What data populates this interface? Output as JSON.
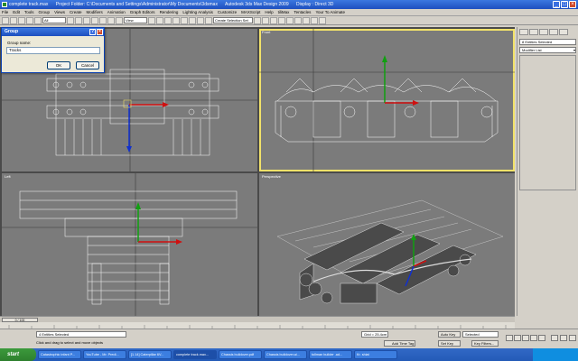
{
  "window": {
    "file": "complete track.max",
    "folder": "Project Folder: C:\\Documents and Settings\\Administrator\\My Documents\\3dsmax",
    "app": "Autodesk 3ds Max Design 2009",
    "display": "Display : Direct 3D"
  },
  "menu": [
    "File",
    "Edit",
    "Tools",
    "Group",
    "Views",
    "Create",
    "Modifiers",
    "Animation",
    "Graph Editors",
    "Rendering",
    "Lighting Analysis",
    "Customize",
    "MAXScript",
    "Help",
    "tiliMax",
    "Tentacles",
    "Your To Animate"
  ],
  "toolbar": {
    "filter": "All",
    "view": "View",
    "selection_set": "Create Selection Set"
  },
  "viewports": {
    "top": "Top",
    "front": "Front",
    "left": "Left",
    "perspective": "Perspective"
  },
  "command_panel": {
    "selection": "8 Entities Selected",
    "modifier_list": "Modifier List"
  },
  "timeline": {
    "slider": "0 / 100"
  },
  "status": {
    "selected": "4 Entities Selected",
    "prompt": "Click and drag to select and move objects",
    "grid": "Grid = 25.4cm",
    "add_time_tag": "Add Time Tag",
    "auto_key": "Auto Key",
    "set_key": "Set Key",
    "selected_dropdown": "Selected",
    "key_filters": "Key Filters..."
  },
  "dialog": {
    "title": "Group",
    "group_name_label": "Group name:",
    "group_name_value": "Tracks",
    "ok": "OK",
    "cancel": "Cancel"
  },
  "taskbar": {
    "start": "start",
    "tasks": [
      "Catastrophic infant P...",
      "YouTube - Mr. Predi...",
      "[1.14] Caterpillar 6V...",
      "complete track.max...",
      "Chassis buildover.pdf",
      "Chassis buildover.ai...",
      "tollman builder .ad...",
      "Kr. shiat"
    ]
  },
  "colors": {
    "viewport_bg": "#7b7b7b",
    "active_border": "#f2e26a",
    "gizmo_x": "#d01010",
    "gizmo_y": "#10a010",
    "gizmo_z": "#1030d0"
  }
}
